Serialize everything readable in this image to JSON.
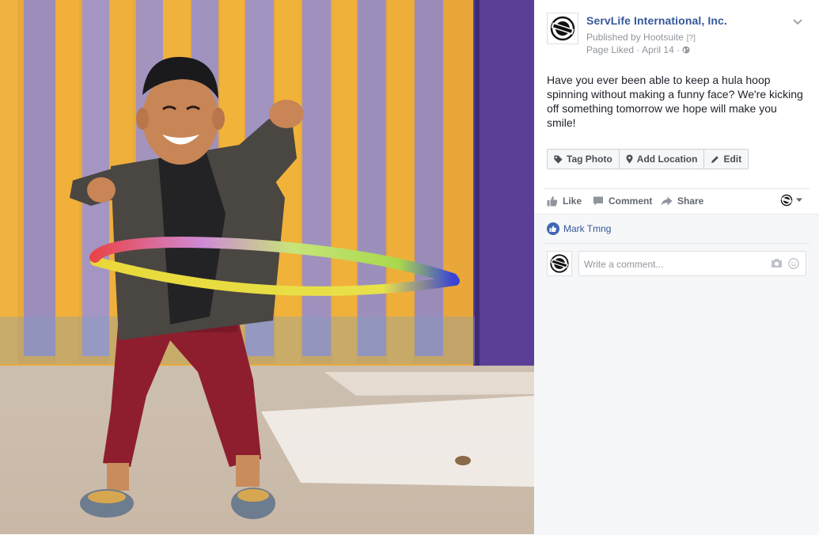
{
  "post": {
    "page_name": "ServLife International, Inc.",
    "published_by": "Published by Hootsuite",
    "published_help": "[?]",
    "meta_prefix": "Page Liked",
    "meta_separator": "·",
    "date": "April 14",
    "privacy_icon": "globe-icon",
    "text": "Have you ever been able to keep a hula hoop spinning without making a funny face? We're kicking off something tomorrow we hope will make you smile!"
  },
  "photo_actions": {
    "tag_label": "Tag Photo",
    "location_label": "Add Location",
    "edit_label": "Edit"
  },
  "ufi": {
    "like_label": "Like",
    "comment_label": "Comment",
    "share_label": "Share",
    "liker_name": "Mark Tmng",
    "comment_placeholder": "Write a comment..."
  },
  "colors": {
    "link_blue": "#365899",
    "like_blue": "#4267b2",
    "muted_text": "#90949c",
    "action_text": "#616770",
    "ufi_background": "#f6f7f9"
  },
  "icons": [
    "chevron-down-icon",
    "tag-icon",
    "pin-icon",
    "pencil-icon",
    "thumbs-up-icon",
    "comment-icon",
    "share-icon",
    "camera-icon",
    "smiley-icon"
  ]
}
